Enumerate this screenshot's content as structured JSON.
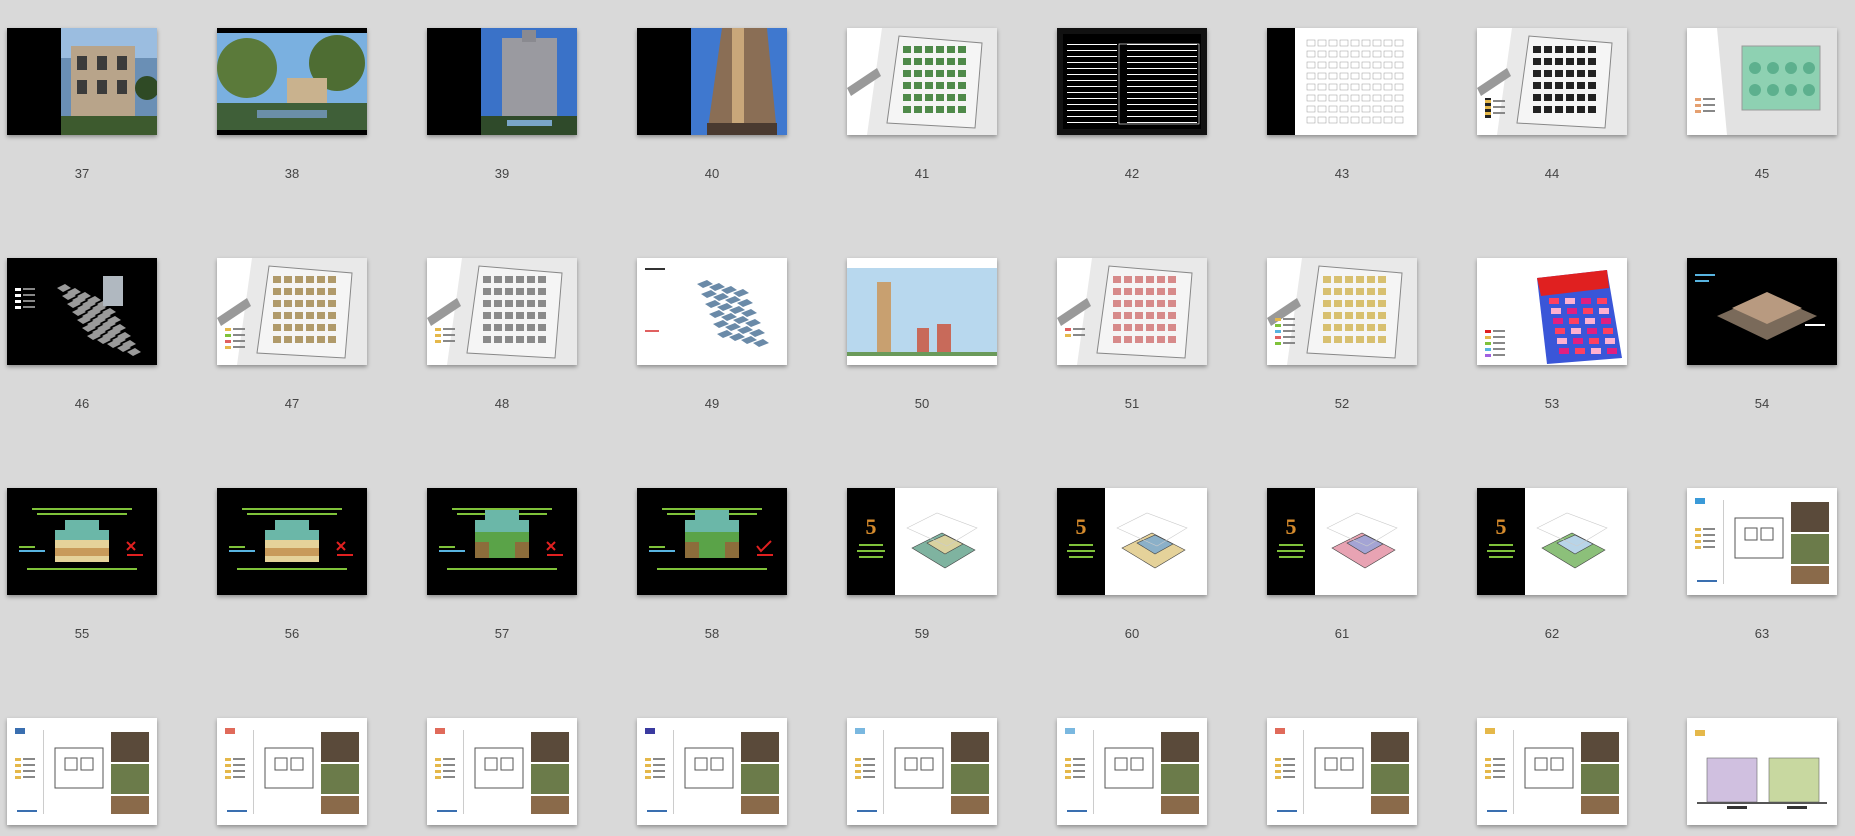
{
  "slides": [
    {
      "number": "37",
      "kind": "photo-villa"
    },
    {
      "number": "38",
      "kind": "photo-garden"
    },
    {
      "number": "39",
      "kind": "photo-tower"
    },
    {
      "number": "40",
      "kind": "photo-tower-close"
    },
    {
      "number": "41",
      "kind": "siteplan-green"
    },
    {
      "number": "42",
      "kind": "table-dark"
    },
    {
      "number": "43",
      "kind": "lineplan"
    },
    {
      "number": "44",
      "kind": "siteplan-dark-blocks"
    },
    {
      "number": "45",
      "kind": "siteplan-greenfield"
    },
    {
      "number": "46",
      "kind": "iso-dark"
    },
    {
      "number": "47",
      "kind": "siteplan-brown"
    },
    {
      "number": "48",
      "kind": "siteplan-gray"
    },
    {
      "number": "49",
      "kind": "iso-white"
    },
    {
      "number": "50",
      "kind": "elevation-sky"
    },
    {
      "number": "51",
      "kind": "siteplan-pink"
    },
    {
      "number": "52",
      "kind": "siteplan-color"
    },
    {
      "number": "53",
      "kind": "heatmap-iso"
    },
    {
      "number": "54",
      "kind": "model-dark"
    },
    {
      "number": "55",
      "kind": "stack-cross"
    },
    {
      "number": "56",
      "kind": "stack-cross"
    },
    {
      "number": "57",
      "kind": "stack-tall-cross"
    },
    {
      "number": "58",
      "kind": "stack-tall-check"
    },
    {
      "number": "59",
      "kind": "five-iso-1"
    },
    {
      "number": "60",
      "kind": "five-iso-2"
    },
    {
      "number": "61",
      "kind": "five-iso-3"
    },
    {
      "number": "62",
      "kind": "five-iso-4"
    },
    {
      "number": "63",
      "kind": "floorplan-photo"
    },
    {
      "number": "",
      "kind": "floorplan-photo"
    },
    {
      "number": "",
      "kind": "floorplan-photo"
    },
    {
      "number": "",
      "kind": "floorplan-photo"
    },
    {
      "number": "",
      "kind": "floorplan-photo"
    },
    {
      "number": "",
      "kind": "floorplan-photo"
    },
    {
      "number": "",
      "kind": "floorplan-photo"
    },
    {
      "number": "",
      "kind": "floorplan-photo"
    },
    {
      "number": "",
      "kind": "floorplan-photo"
    },
    {
      "number": "",
      "kind": "section"
    }
  ],
  "colors": {
    "background": "#d9d9d9",
    "slide_dark": "#000000",
    "slide_light": "#ffffff",
    "accent_green": "#7fc23a",
    "accent_red": "#e02020"
  }
}
